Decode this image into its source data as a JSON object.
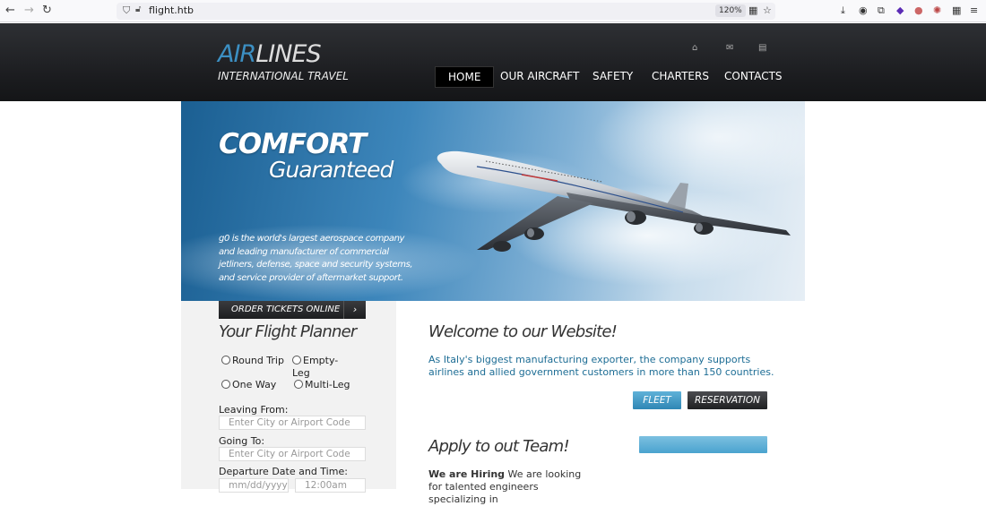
{
  "browser": {
    "url": "flight.htb",
    "zoom": "120%"
  },
  "site": {
    "logo_air": "AIR",
    "logo_lines": "LINES",
    "logo_tagline": "INTERNATIONAL TRAVEL",
    "header_icons": [
      "home-icon",
      "mail-icon",
      "sitemap-icon"
    ],
    "menu": [
      {
        "label": "HOME",
        "active": true
      },
      {
        "label": "OUR AIRCRAFT"
      },
      {
        "label": "SAFETY"
      },
      {
        "label": "CHARTERS"
      },
      {
        "label": "CONTACTS"
      }
    ]
  },
  "hero": {
    "title": "COMFORT",
    "subtitle": "Guaranteed",
    "text": "g0 is the world's largest aerospace company and leading manufacturer of commercial jetliners, defense, space and security systems, and service provider of aftermarket support."
  },
  "planner": {
    "order_button": "ORDER TICKETS ONLINE",
    "title": "Your Flight Planner",
    "trip_types": [
      "Round Trip",
      "Empty-Leg",
      "One Way",
      "Multi-Leg"
    ],
    "leaving_label": "Leaving From:",
    "leaving_placeholder": "Enter City or Airport Code",
    "going_label": "Going To:",
    "going_placeholder": "Enter City or Airport Code",
    "departure_label": "Departure Date and Time:",
    "date_placeholder": "mm/dd/yyyy",
    "time_placeholder": "12:00am"
  },
  "content": {
    "welcome_title": "Welcome to our Website!",
    "intro": "As Italy's biggest manufacturing exporter, the company supports airlines and allied government customers in more than 150 countries.",
    "fleet_button": "FLEET",
    "reservation_button": "RESERVATION",
    "apply_title": "Apply to out Team!",
    "hiring_bold": "We are Hiring",
    "hiring_text": " We are looking for talented engineers specializing in"
  },
  "colors": {
    "header_bg": "#1b1c1f",
    "logo_accent": "#3c8fc2",
    "intro_text": "#1d6d95",
    "fleet_button": "#2f87b5"
  }
}
